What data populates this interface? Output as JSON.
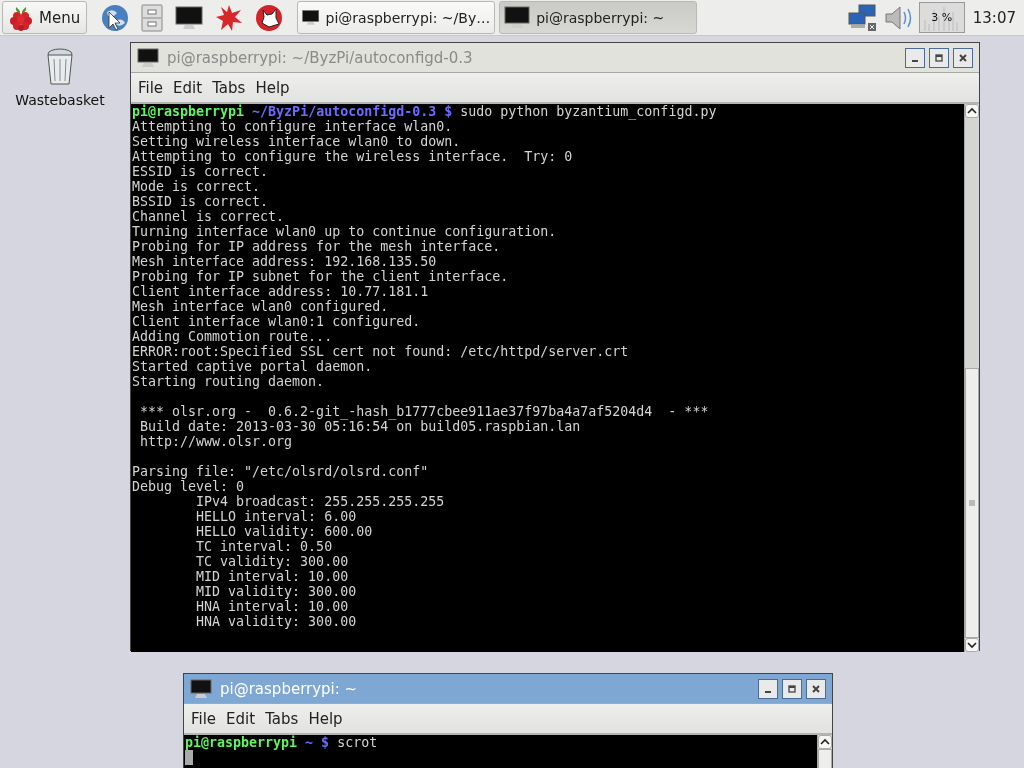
{
  "taskbar": {
    "menu_label": "Menu",
    "launchers": [
      {
        "kind": "browser"
      },
      {
        "kind": "files"
      },
      {
        "kind": "terminal"
      },
      {
        "kind": "star"
      },
      {
        "kind": "wolf"
      }
    ],
    "tasks": [
      {
        "title": "pi@raspberrypi: ~/By…",
        "selected": false
      },
      {
        "title": "pi@raspberrypi: ~",
        "selected": true
      }
    ],
    "cpu_reading": "3 %",
    "clock": "13:07"
  },
  "desktop_icons": [
    {
      "label": "Wastebasket"
    }
  ],
  "windows": [
    {
      "title": "pi@raspberrypi: ~/ByzPi/autoconfigd-0.3",
      "focused": false,
      "menu": [
        "File",
        "Edit",
        "Tabs",
        "Help"
      ],
      "cursor": false,
      "lines": [
        {
          "kind": "prompt",
          "user": "pi@raspberrypi",
          "path": "~/ByzPi/autoconfigd-0.3",
          "symbol": "$",
          "command": "sudo python byzantium_configd.py"
        },
        {
          "kind": "output",
          "text": "Attempting to configure interface wlan0."
        },
        {
          "kind": "output",
          "text": "Setting wireless interface wlan0 to down."
        },
        {
          "kind": "output",
          "text": "Attempting to configure the wireless interface.  Try: 0"
        },
        {
          "kind": "output",
          "text": "ESSID is correct."
        },
        {
          "kind": "output",
          "text": "Mode is correct."
        },
        {
          "kind": "output",
          "text": "BSSID is correct."
        },
        {
          "kind": "output",
          "text": "Channel is correct."
        },
        {
          "kind": "output",
          "text": "Turning interface wlan0 up to continue configuration."
        },
        {
          "kind": "output",
          "text": "Probing for IP address for the mesh interface."
        },
        {
          "kind": "output",
          "text": "Mesh interface address: 192.168.135.50"
        },
        {
          "kind": "output",
          "text": "Probing for IP subnet for the client interface."
        },
        {
          "kind": "output",
          "text": "Client interface address: 10.77.181.1"
        },
        {
          "kind": "output",
          "text": "Mesh interface wlan0 configured."
        },
        {
          "kind": "output",
          "text": "Client interface wlan0:1 configured."
        },
        {
          "kind": "output",
          "text": "Adding Commotion route..."
        },
        {
          "kind": "output",
          "text": "ERROR:root:Specified SSL cert not found: /etc/httpd/server.crt"
        },
        {
          "kind": "output",
          "text": "Started captive portal daemon."
        },
        {
          "kind": "output",
          "text": "Starting routing daemon."
        },
        {
          "kind": "blank"
        },
        {
          "kind": "output",
          "text": " *** olsr.org -  0.6.2-git_-hash_b1777cbee911ae37f97ba4a7af5204d4  - ***"
        },
        {
          "kind": "output",
          "text": " Build date: 2013-03-30 05:16:54 on build05.raspbian.lan"
        },
        {
          "kind": "output",
          "text": " http://www.olsr.org"
        },
        {
          "kind": "blank"
        },
        {
          "kind": "output",
          "text": "Parsing file: \"/etc/olsrd/olsrd.conf\""
        },
        {
          "kind": "output",
          "text": "Debug level: 0"
        },
        {
          "kind": "output",
          "text": "        IPv4 broadcast: 255.255.255.255"
        },
        {
          "kind": "output",
          "text": "        HELLO interval: 6.00"
        },
        {
          "kind": "output",
          "text": "        HELLO validity: 600.00"
        },
        {
          "kind": "output",
          "text": "        TC interval: 0.50"
        },
        {
          "kind": "output",
          "text": "        TC validity: 300.00"
        },
        {
          "kind": "output",
          "text": "        MID interval: 10.00"
        },
        {
          "kind": "output",
          "text": "        MID validity: 300.00"
        },
        {
          "kind": "output",
          "text": "        HNA interval: 10.00"
        },
        {
          "kind": "output",
          "text": "        HNA validity: 300.00"
        }
      ]
    },
    {
      "title": "pi@raspberrypi: ~",
      "focused": true,
      "menu": [
        "File",
        "Edit",
        "Tabs",
        "Help"
      ],
      "cursor": true,
      "lines": [
        {
          "kind": "prompt",
          "user": "pi@raspberrypi",
          "path": "~",
          "symbol": "$",
          "command": "scrot"
        }
      ]
    }
  ]
}
